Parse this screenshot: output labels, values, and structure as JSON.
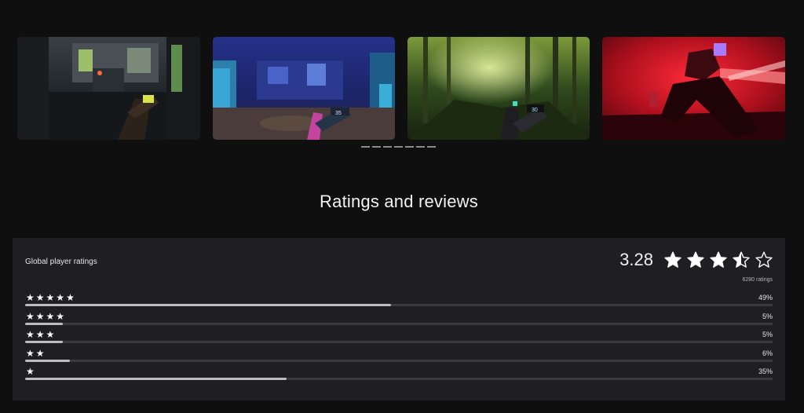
{
  "carousel": {
    "screenshots": [
      {
        "icon": "industrial-corridor-scene"
      },
      {
        "icon": "blue-laboratory-scene"
      },
      {
        "icon": "green-forest-scene"
      },
      {
        "icon": "red-robot-scene"
      }
    ],
    "page_count": 7,
    "hud_ammo_2": "35",
    "hud_ammo_3": "30"
  },
  "ratings": {
    "section_title": "Ratings and reviews",
    "panel_label": "Global player ratings",
    "average": "3.28",
    "average_stars": 3.28,
    "count_text": "6280 ratings",
    "star_glyph": "★",
    "rows": [
      {
        "stars": 5,
        "percent": 49,
        "percent_text": "49%"
      },
      {
        "stars": 4,
        "percent": 5,
        "percent_text": "5%"
      },
      {
        "stars": 3,
        "percent": 5,
        "percent_text": "5%"
      },
      {
        "stars": 2,
        "percent": 6,
        "percent_text": "6%"
      },
      {
        "stars": 1,
        "percent": 35,
        "percent_text": "35%"
      }
    ]
  },
  "colors": {
    "background": "#0f0f10",
    "panel": "#1f1f23",
    "bar_track": "#3a3a3f",
    "bar_fill": "#bdbdbd"
  }
}
